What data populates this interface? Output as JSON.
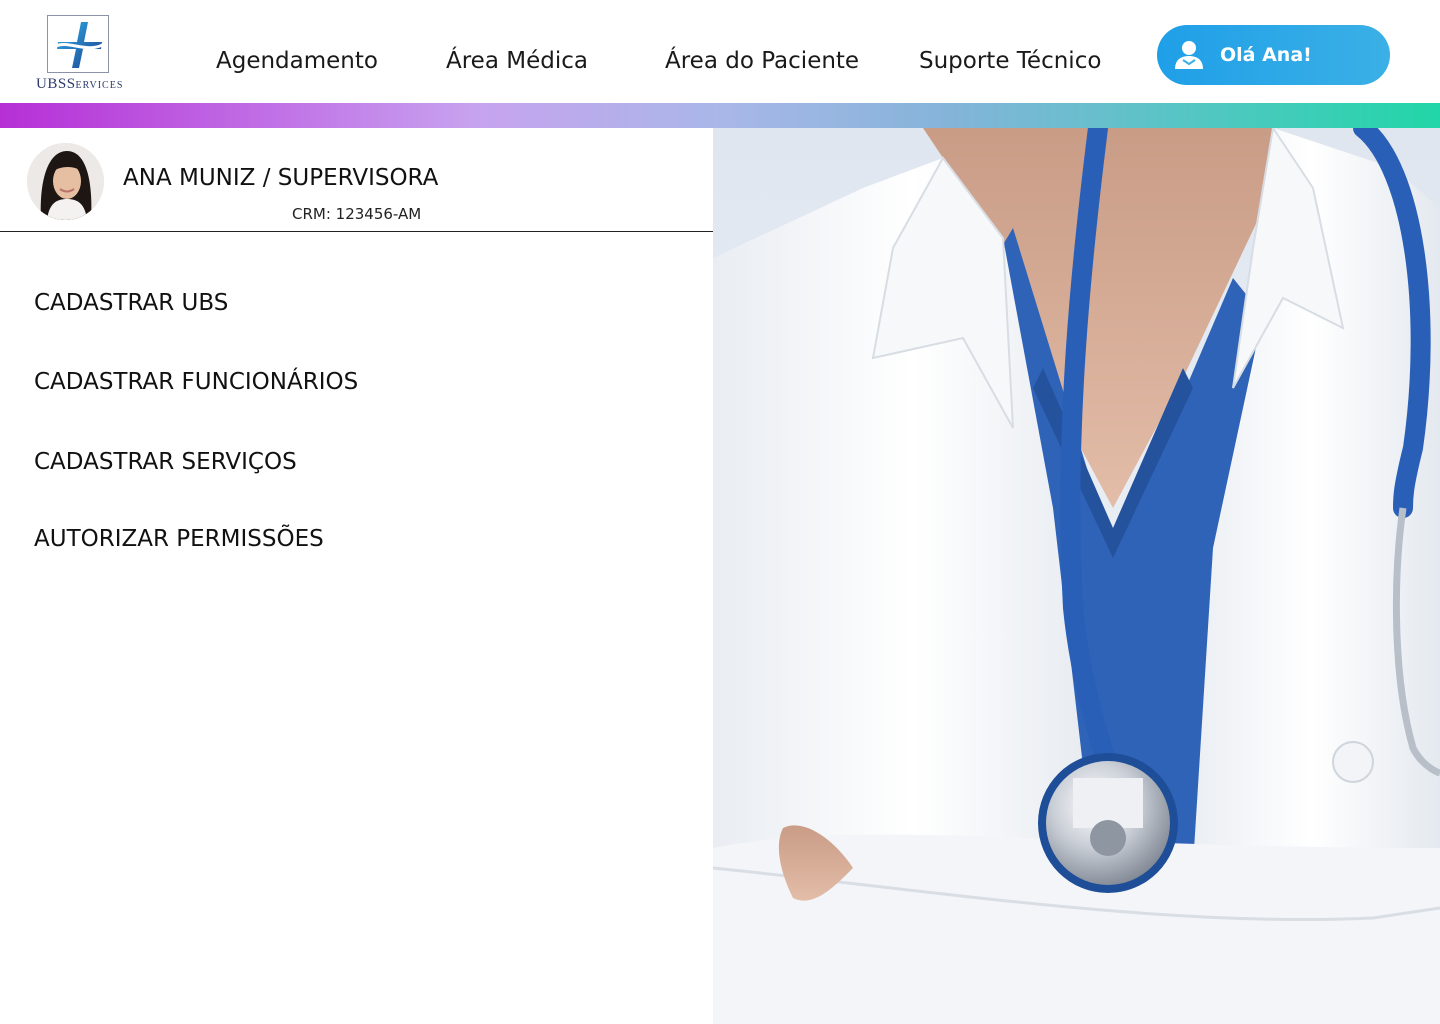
{
  "brand": {
    "logo_text_main": "UBS",
    "logo_text_suffix": "ERVICES",
    "logo_text_s": "S",
    "logo_icon": "medical-cross-icon"
  },
  "nav": {
    "items": [
      {
        "label": "Agendamento"
      },
      {
        "label": "Área Médica"
      },
      {
        "label": "Área do Paciente"
      },
      {
        "label": "Suporte Técnico"
      }
    ]
  },
  "user": {
    "greeting": "Olá Ana!",
    "icon": "user-icon"
  },
  "profile": {
    "name": "ANA MUNIZ / SUPERVISORA",
    "crm": "CRM: 123456-AM"
  },
  "menu": {
    "items": [
      {
        "label": "CADASTRAR UBS"
      },
      {
        "label": "CADASTRAR FUNCIONÁRIOS"
      },
      {
        "label": "CADASTRAR SERVIÇOS"
      },
      {
        "label": "AUTORIZAR PERMISSÕES"
      }
    ]
  },
  "colors": {
    "accent_button": "#1f9fe8",
    "gradient_start": "#b62fd6",
    "gradient_end": "#21d6a8",
    "scrubs": "#2f63b8",
    "brand_navy": "#2b3a6b"
  }
}
